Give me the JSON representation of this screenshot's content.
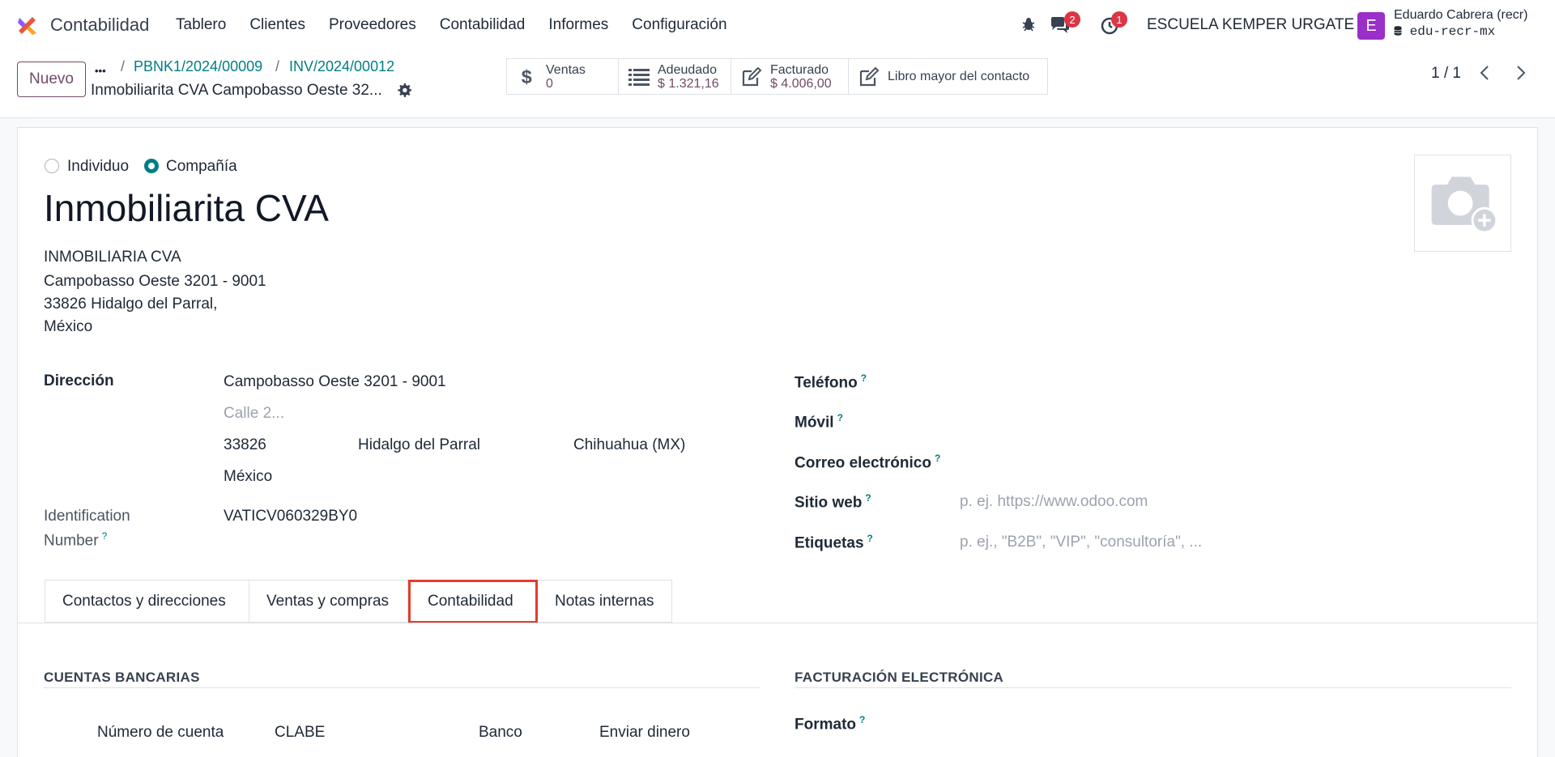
{
  "navbar": {
    "app_name": "Contabilidad",
    "menu": [
      "Tablero",
      "Clientes",
      "Proveedores",
      "Contabilidad",
      "Informes",
      "Configuración"
    ],
    "messages_count": "2",
    "activities_count": "1",
    "company": "ESCUELA KEMPER URGATE",
    "avatar_letter": "E",
    "user_name": "Eduardo Cabrera (recr)",
    "database": "edu-recr-mx"
  },
  "control_panel": {
    "new_label": "Nuevo",
    "breadcrumb_dots": "•••",
    "breadcrumbs": [
      "PBNK1/2024/00009",
      "INV/2024/00012"
    ],
    "record_title": "Inmobiliarita CVA Campobasso Oeste 32...",
    "smart_buttons": [
      {
        "label": "Ventas",
        "value": "0",
        "icon": "dollar-icon"
      },
      {
        "label": "Adeudado",
        "value": "$ 1.321,16",
        "icon": "list-icon"
      },
      {
        "label": "Facturado",
        "value": "$ 4.006,00",
        "icon": "edit-icon"
      },
      {
        "label": "Libro mayor del contacto",
        "value": "",
        "icon": "edit-icon"
      }
    ],
    "pager": "1 / 1"
  },
  "form": {
    "type_options": {
      "individual": "Individuo",
      "company": "Compañía"
    },
    "selected_type": "Compañía",
    "partner_name": "Inmobiliarita CVA",
    "address_block": [
      "INMOBILIARIA CVA",
      "Campobasso Oeste 3201 - 9001",
      "33826 Hidalgo del Parral,",
      "México"
    ],
    "address_label": "Dirección",
    "street": "Campobasso Oeste 3201 - 9001",
    "street2_placeholder": "Calle 2...",
    "zip": "33826",
    "city": "Hidalgo del Parral",
    "state": "Chihuahua (MX)",
    "country": "México",
    "id_label_line1": "Identification",
    "id_label_line2": "Number",
    "id_value": "VATICV060329BY0",
    "phone_label": "Teléfono",
    "mobile_label": "Móvil",
    "email_label": "Correo electrónico",
    "website_label": "Sitio web",
    "website_placeholder": "p. ej. https://www.odoo.com",
    "tags_label": "Etiquetas",
    "tags_placeholder": "p. ej., \"B2B\", \"VIP\", \"consultoría\", ..."
  },
  "tabs": [
    "Contactos y direcciones",
    "Ventas y compras",
    "Contabilidad",
    "Notas internas"
  ],
  "active_tab": "Contabilidad",
  "accounting": {
    "bank_section": "CUENTAS BANCARIAS",
    "bank_columns": [
      "Número de cuenta",
      "CLABE",
      "Banco",
      "Enviar dinero"
    ],
    "einvoice_section": "FACTURACIÓN ELECTRÓNICA",
    "format_label": "Formato"
  },
  "colors": {
    "brand": "#714b67",
    "accent": "#017e84",
    "highlight": "#e03e2d"
  }
}
